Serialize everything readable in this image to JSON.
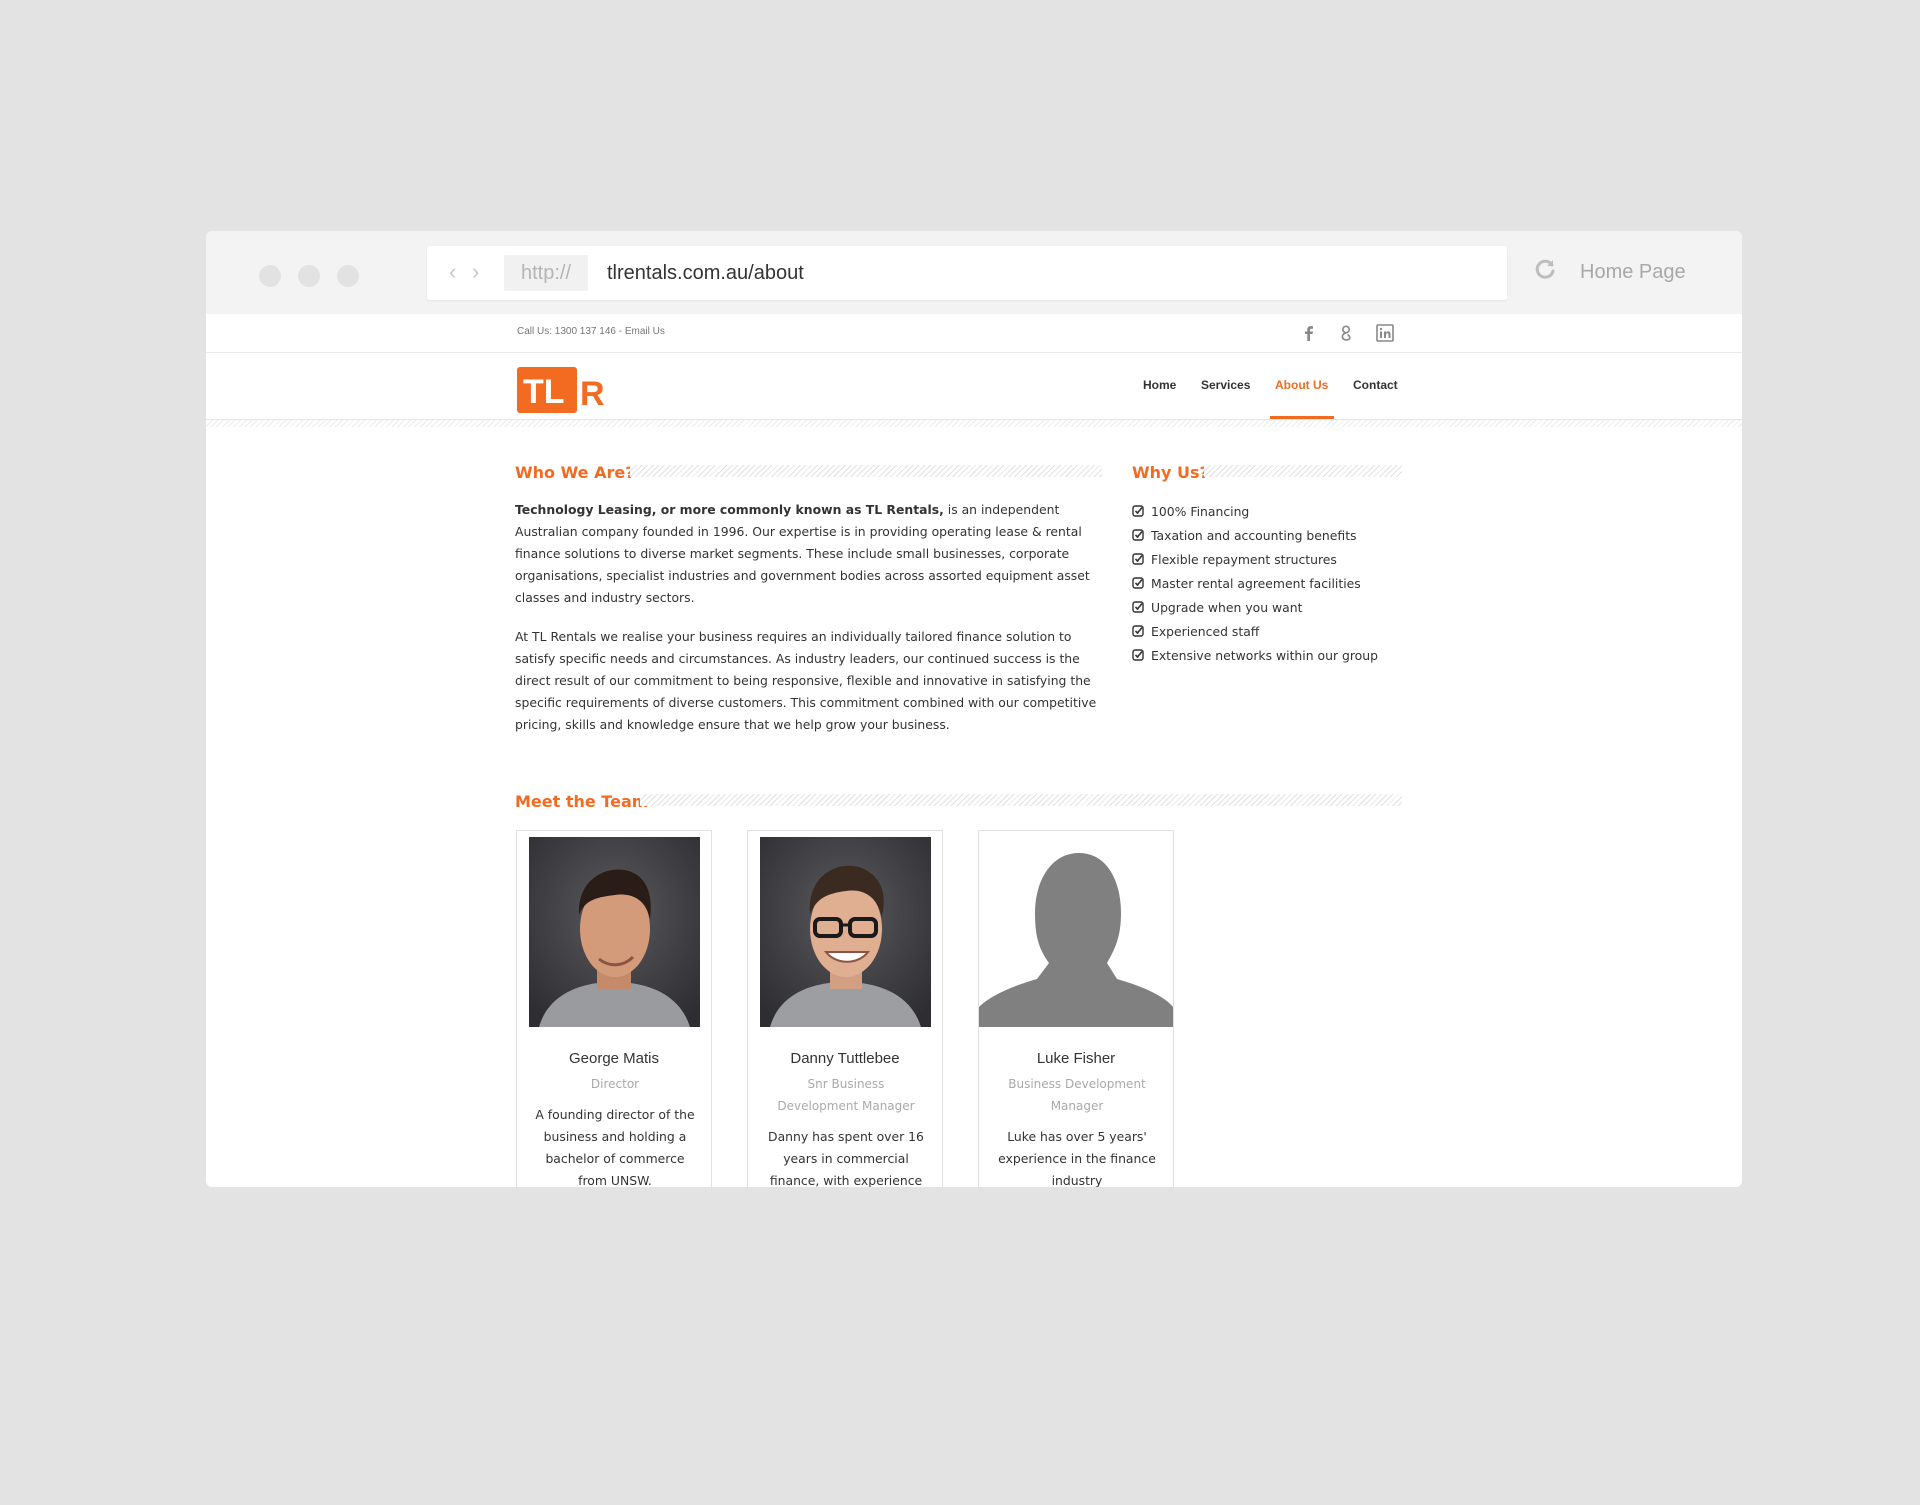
{
  "browser": {
    "protocol": "http://",
    "url": "tlrentals.com.au/about",
    "home_label": "Home Page"
  },
  "topbar": {
    "call_text": "Call Us: 1300 137 146 - Email Us",
    "social": [
      "facebook-icon",
      "google-plus-icon",
      "linkedin-icon"
    ]
  },
  "logo": {
    "text_left": "TL",
    "text_right": "R",
    "color": "#f26b21"
  },
  "nav": {
    "items": [
      {
        "label": "Home"
      },
      {
        "label": "Services"
      },
      {
        "label": "About Us"
      },
      {
        "label": "Contact"
      }
    ],
    "active": "About Us"
  },
  "who": {
    "title": "Who We Are?",
    "p1_bold": "Technology Leasing, or more commonly known as TL Rentals,",
    "p1_rest": " is an independent Australian company founded in 1996. Our expertise is in providing operating lease & rental finance solutions to diverse market segments. These include small businesses, corporate organisations, specialist industries and government bodies across assorted equipment asset classes and industry sectors.",
    "p2": "At TL Rentals we realise your business requires an individually tailored finance solution to satisfy specific needs and circumstances. As industry leaders, our continued success is the direct result of our commitment to being responsive, flexible and innovative in satisfying the specific requirements of diverse customers. This commitment combined with our competitive pricing, skills and knowledge ensure that we help grow your business."
  },
  "why": {
    "title": "Why Us?",
    "items": [
      "100% Financing",
      "Taxation and accounting benefits",
      "Flexible repayment structures",
      "Master rental agreement facilities",
      "Upgrade when you want",
      "Experienced staff",
      "Extensive networks within our group"
    ]
  },
  "team": {
    "title": "Meet the Team",
    "members": [
      {
        "name": "George Matis",
        "role": "Director",
        "bio": "A founding director of the business and holding a bachelor of commerce from UNSW."
      },
      {
        "name": "Danny Tuttlebee",
        "role": "Snr Business Development Manager",
        "bio": "Danny has spent over 16 years in commercial finance, with experience"
      },
      {
        "name": "Luke Fisher",
        "role": "Business Development Manager",
        "bio": "Luke has over 5 years' experience in the finance industry"
      }
    ]
  },
  "colors": {
    "accent": "#f26b21",
    "text": "#333333",
    "muted": "#aaaaaa"
  }
}
